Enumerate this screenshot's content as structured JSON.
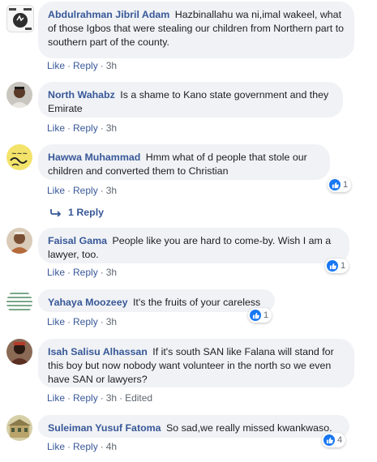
{
  "colors": {
    "name": "#385898",
    "bubble": "#f0f2f5",
    "like_badge": "#1877f2",
    "meta": "#606770"
  },
  "comments": [
    {
      "author": "Abdulrahman Jibril Adam",
      "text": "Hazbinallahu wa ni,imal wakeel, what of those Igbos that were stealing our children from Northern part to southern part of the county.",
      "like": "Like",
      "reply": "Reply",
      "time": "3h",
      "avatar_icon": "wowa-logo-avatar"
    },
    {
      "author": "North Wahabz",
      "text": "Is a shame to Kano state government and they Emirate",
      "like": "Like",
      "reply": "Reply",
      "time": "3h",
      "avatar_icon": "person-photo-avatar"
    },
    {
      "author": "Hawwa Muhammad",
      "text": "Hmm what of d people that stole our children and converted them to Christian",
      "like": "Like",
      "reply": "Reply",
      "time": "3h",
      "reactions": "1",
      "avatar_icon": "calligraphy-avatar"
    },
    {
      "author": "Faisal Gama",
      "text": "People like you are hard to come-by. Wish I am a lawyer, too.",
      "like": "Like",
      "reply": "Reply",
      "time": "3h",
      "reactions": "1",
      "avatar_icon": "person-photo-avatar"
    },
    {
      "author": "Yahaya Moozeey",
      "text": "It's the fruits of your careless",
      "like": "Like",
      "reply": "Reply",
      "time": "3h",
      "reactions": "1",
      "avatar_icon": "striped-avatar"
    },
    {
      "author": "Isah Salisu Alhassan",
      "text": "If it's south SAN like Falana will stand for this boy but now nobody want volunteer in the north so we even have SAN or lawyers?",
      "like": "Like",
      "reply": "Reply",
      "time": "3h",
      "edited": "Edited",
      "avatar_icon": "person-photo-avatar"
    },
    {
      "author": "Suleiman Yusuf Fatoma",
      "text": "So sad,we really missed kwankwaso.",
      "like": "Like",
      "reply": "Reply",
      "time": "4h",
      "reactions": "4",
      "avatar_icon": "building-avatar"
    }
  ],
  "replies_link": "1 Reply"
}
